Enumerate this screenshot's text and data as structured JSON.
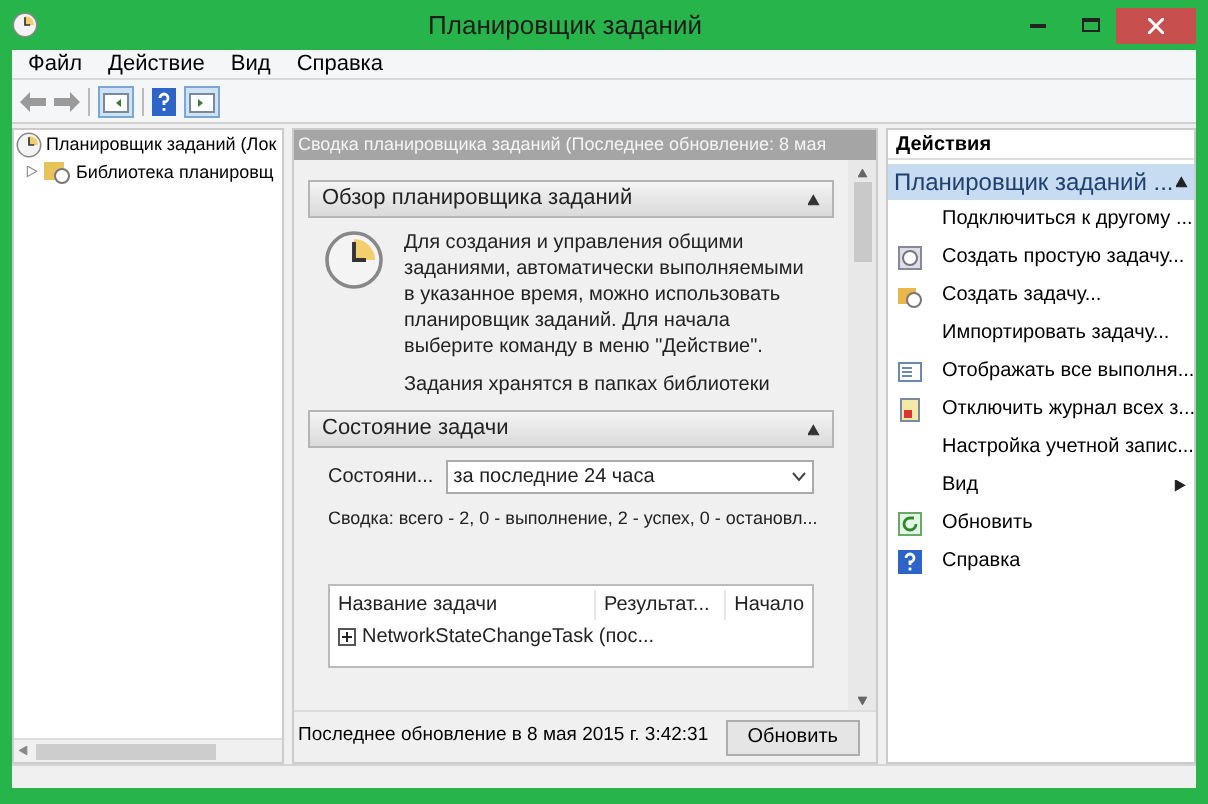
{
  "window": {
    "title": "Планировщик заданий"
  },
  "menu": [
    "Файл",
    "Действие",
    "Вид",
    "Справка"
  ],
  "tree": [
    {
      "label": "Планировщик заданий (Лок",
      "selected": false,
      "children": [
        {
          "label": "Библиотека планировщ",
          "selected": false,
          "expanded": false
        }
      ]
    }
  ],
  "summary": {
    "header": "Сводка планировщика заданий (Последнее обновление: 8 мая",
    "overview": {
      "title": "Обзор планировщика заданий",
      "expanded": true,
      "paragraphs": [
        "Для создания и управления общими заданиями, автоматически выполняемыми в указанное время, можно использовать планировщик заданий. Для начала выберите команду в меню \"Действие\".",
        "Задания хранятся в папках библиотеки"
      ]
    },
    "status": {
      "title": "Состояние задачи",
      "expanded": true,
      "filter_label": "Состояни...",
      "filter_value": "за последние 24 часа",
      "summary": "Сводка: всего - 2, 0 - выполнение, 2 - успех, 0 - остановл...",
      "columns": [
        "Название задачи",
        "Результат...",
        "Начало"
      ],
      "rows": [
        {
          "name": "NetworkStateChangeTask (пос...",
          "expanded": false
        }
      ]
    },
    "footer": {
      "text": "Последнее обновление в 8 мая 2015 г. 3:42:31",
      "button": "Обновить"
    }
  },
  "actions": {
    "title": "Действия",
    "group": {
      "title": "Планировщик заданий ...",
      "expanded": true,
      "items": [
        {
          "label": "Подключиться к другому ...",
          "kind": "plain"
        },
        {
          "label": "Создать простую задачу...",
          "kind": "wizard"
        },
        {
          "label": "Создать задачу...",
          "kind": "task"
        },
        {
          "label": "Импортировать задачу...",
          "kind": "plain"
        },
        {
          "label": "Отображать все выполня...",
          "kind": "list"
        },
        {
          "label": "Отключить журнал всех з...",
          "kind": "journal"
        },
        {
          "label": "Настройка учетной запис...",
          "kind": "plain"
        },
        {
          "label": "Вид",
          "kind": "submenu"
        },
        {
          "label": "Обновить",
          "kind": "refresh"
        },
        {
          "label": "Справка",
          "kind": "help"
        }
      ]
    }
  }
}
